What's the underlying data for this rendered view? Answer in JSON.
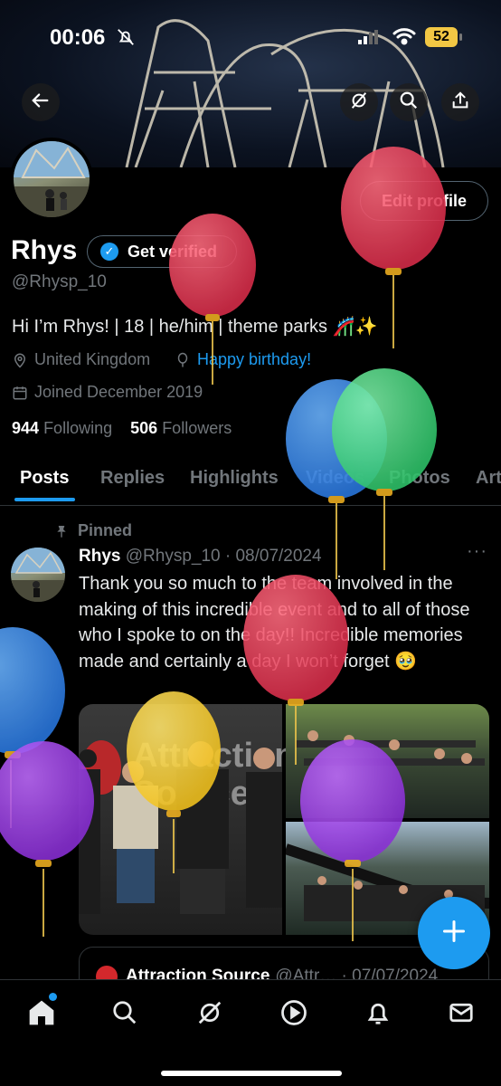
{
  "status_bar": {
    "time": "00:06",
    "battery": "52"
  },
  "profile": {
    "edit_label": "Edit profile",
    "name": "Rhys",
    "verify_label": "Get verified",
    "handle": "@Rhysp_10",
    "bio": "Hi I’m Rhys! | 18 | he/him | theme parks 🎢✨",
    "location": "United Kingdom",
    "birthday": "Happy birthday!",
    "joined": "Joined December 2019",
    "following_count": "944",
    "following_label": "Following",
    "followers_count": "506",
    "followers_label": "Followers"
  },
  "tabs": [
    "Posts",
    "Replies",
    "Highlights",
    "Videos",
    "Photos",
    "Art"
  ],
  "post": {
    "pinned_label": "Pinned",
    "author": "Rhys",
    "handle_date": "@Rhysp_10 · 08/07/2024",
    "more": "···",
    "text": "Thank you so much to the team involved in the making of this incredible event and to all of those who I spoke to on the day!! Incredible memories made and certainly a day I won’t forget 🥹",
    "media_text": "Attraction Source"
  },
  "quote": {
    "author": "Attraction Source",
    "handle_date": "@Attr… · 07/07/2024"
  },
  "colors": {
    "accent": "#1d9bf0",
    "background": "#000000",
    "muted": "#71767b"
  }
}
